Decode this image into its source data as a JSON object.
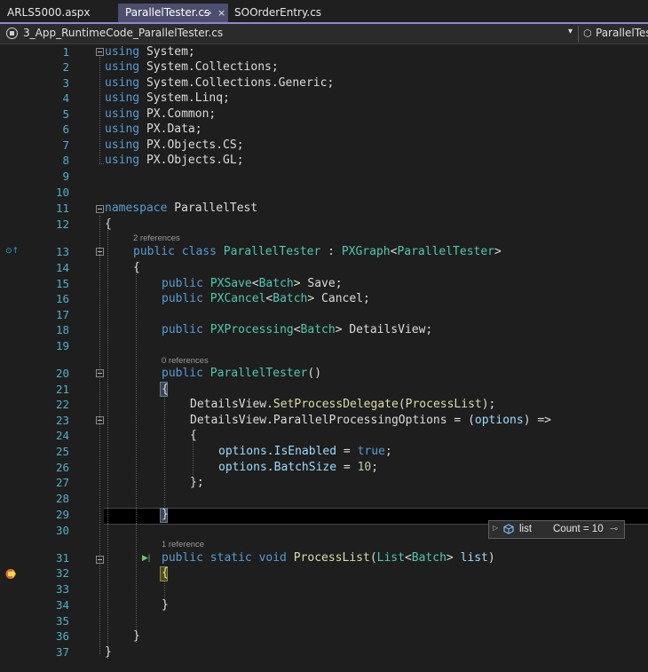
{
  "tabs": [
    {
      "label": "ARLS5000.aspx",
      "active": false
    },
    {
      "label": "ParallelTester.cs",
      "active": true
    },
    {
      "label": "SOOrderEntry.cs",
      "active": false
    }
  ],
  "tab_controls": {
    "pin": "⊸",
    "close": "×"
  },
  "navbar": {
    "project": "3_App_RuntimeCode_ParallelTester.cs",
    "dropdown_glyph": "▾",
    "member": "ParallelTest."
  },
  "code_lens": {
    "class_refs": "2 references",
    "ctor_refs": "0 references",
    "method_refs": "1 reference"
  },
  "line_numbers": [
    "1",
    "2",
    "3",
    "4",
    "5",
    "6",
    "7",
    "8",
    "9",
    "10",
    "11",
    "12",
    "13",
    "14",
    "15",
    "16",
    "17",
    "18",
    "19",
    "20",
    "21",
    "22",
    "23",
    "24",
    "25",
    "26",
    "27",
    "28",
    "29",
    "30",
    "31",
    "32",
    "33",
    "34",
    "35",
    "36",
    "37"
  ],
  "code": {
    "l1_kw": "using",
    "l1_ns": " System;",
    "l2_kw": "using",
    "l2_ns": " System.Collections;",
    "l3_kw": "using",
    "l3_ns": " System.Collections.Generic;",
    "l4_kw": "using",
    "l4_ns": " System.Linq;",
    "l5_kw": "using",
    "l5_ns": " PX.Common;",
    "l6_kw": "using",
    "l6_ns": " PX.Data;",
    "l7_kw": "using",
    "l7_ns": " PX.Objects.CS;",
    "l8_kw": "using",
    "l8_ns": " PX.Objects.GL;",
    "l11_kw": "namespace",
    "l11_ns": " ParallelTest",
    "l12": "{",
    "l13_kw": "public class",
    "l13_name": "ParallelTester",
    "l13_sep": " : ",
    "l13_base": "PXGraph",
    "l13_lt": "<",
    "l13_arg": "ParallelTester",
    "l13_gt": ">",
    "l14": "{",
    "l15_kw": "public",
    "l15_type": "PXSave",
    "l15_lt": "<",
    "l15_arg": "Batch",
    "l15_rest": "> Save;",
    "l16_kw": "public",
    "l16_type": "PXCancel",
    "l16_lt": "<",
    "l16_arg": "Batch",
    "l16_rest": "> Cancel;",
    "l18_kw": "public",
    "l18_type": "PXProcessing",
    "l18_lt": "<",
    "l18_arg": "Batch",
    "l18_rest": "> DetailsView;",
    "l20_kw": "public",
    "l20_name": "ParallelTester",
    "l20_rest": "()",
    "l21": "{",
    "l22_obj": "DetailsView",
    "l22_dot": ".",
    "l22_m": "SetProcessDelegate",
    "l22_p1": "(",
    "l22_arg": "ProcessList",
    "l22_p2": ");",
    "l23_obj": "DetailsView",
    "l23_dot": ".",
    "l23_prop": "ParallelProcessingOptions",
    "l23_eq": " = (",
    "l23_param": "options",
    "l23_rest": ") =>",
    "l24": "{",
    "l25_obj": "options",
    "l25_dot": ".",
    "l25_prop": "IsEnabled",
    "l25_eq": " = ",
    "l25_val": "true",
    "l25_end": ";",
    "l26_obj": "options",
    "l26_dot": ".",
    "l26_prop": "BatchSize",
    "l26_eq": " = ",
    "l26_val": "10",
    "l26_end": ";",
    "l27": "};",
    "l29": "}",
    "l31_kw": "public static void",
    "l31_name": "ProcessList",
    "l31_p1": "(",
    "l31_type": "List",
    "l31_lt": "<",
    "l31_arg": "Batch",
    "l31_gt": "> ",
    "l31_param": "list",
    "l31_p2": ")",
    "l32": "{",
    "l34": "}",
    "l36": "}",
    "l37": "}"
  },
  "datatip": {
    "name": "list",
    "value": "Count = 10",
    "expand_glyph": "▷",
    "pin_glyph": "⊸"
  },
  "colors": {
    "keyword": "#569cd6",
    "type": "#4ec9b0",
    "method": "#dcdcaa",
    "param": "#9cdcfe",
    "number": "#b5cea8",
    "line_number": "#4fb0c6",
    "tab_accent": "#9184d0"
  }
}
